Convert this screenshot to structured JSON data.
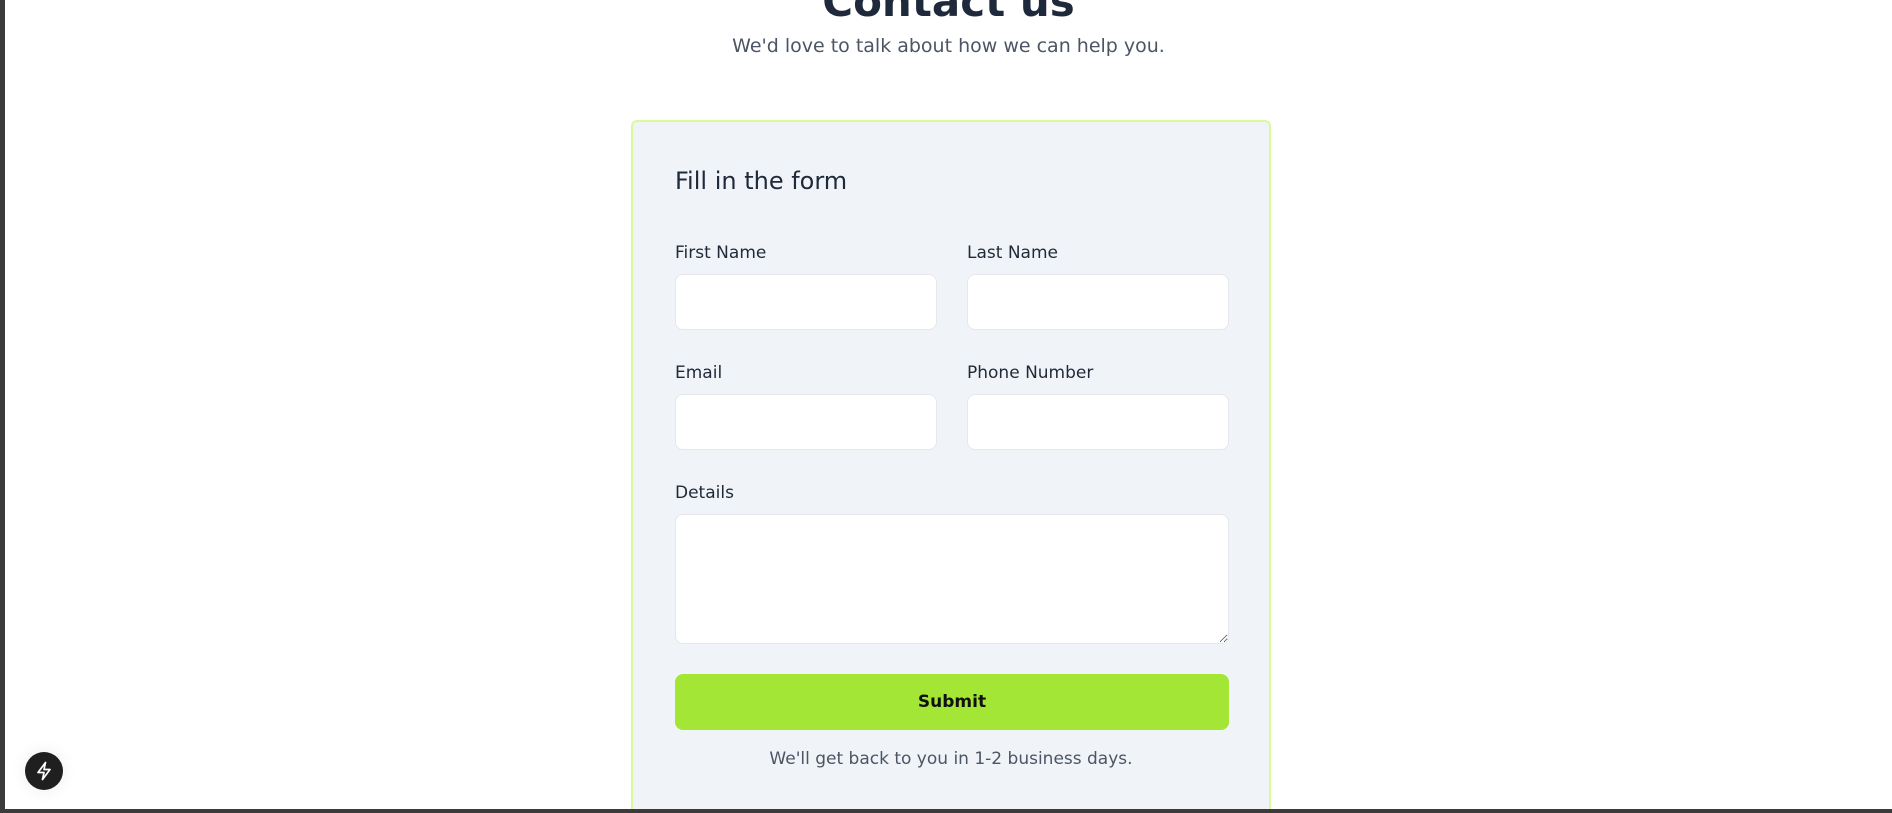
{
  "header": {
    "title": "Contact us",
    "subtitle": "We'd love to talk about how we can help you."
  },
  "form": {
    "heading": "Fill in the form",
    "fields": {
      "first_name": {
        "label": "First Name",
        "value": ""
      },
      "last_name": {
        "label": "Last Name",
        "value": ""
      },
      "email": {
        "label": "Email",
        "value": ""
      },
      "phone": {
        "label": "Phone Number",
        "value": ""
      },
      "details": {
        "label": "Details",
        "value": ""
      }
    },
    "submit_label": "Submit",
    "footnote": "We'll get back to you in 1-2 business days."
  },
  "floating_button": {
    "icon": "lightning-bolt-icon"
  },
  "colors": {
    "accent": "#a3e635",
    "card_border": "#d9f99d",
    "card_background": "#f0f4f8",
    "heading_text": "#1e293b"
  }
}
